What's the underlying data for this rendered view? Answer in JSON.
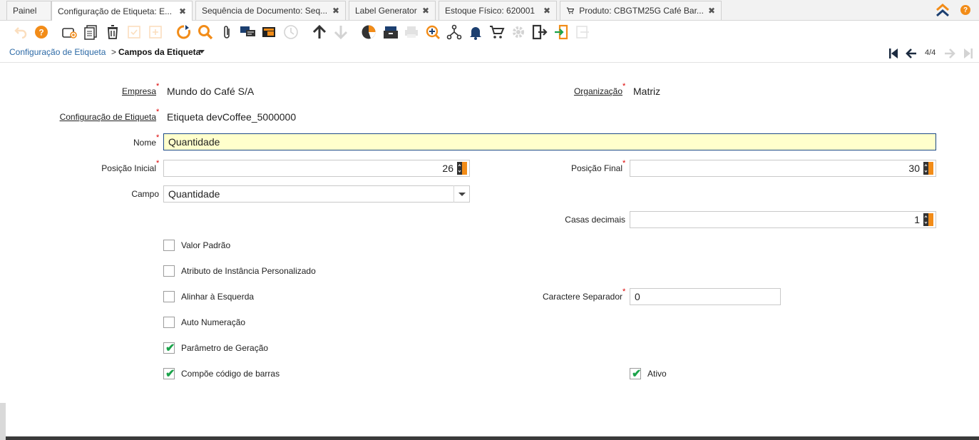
{
  "tabs": [
    {
      "label": "Painel",
      "closable": false
    },
    {
      "label": "Configuração de Etiqueta: E...",
      "closable": true,
      "active": true
    },
    {
      "label": "Sequência de Documento: Seq...",
      "closable": true
    },
    {
      "label": "Label Generator",
      "closable": true
    },
    {
      "label": "Estoque Físico: 620001",
      "closable": true
    },
    {
      "label": "Produto: CBGTM25G Café Bar...",
      "closable": true,
      "icon": "cart-icon"
    }
  ],
  "tab_close_glyph": "✖",
  "help_glyph": "?",
  "toolbar_icons": [
    "undo-icon",
    "help-icon",
    "new-record-icon",
    "copy-icon",
    "delete-icon",
    "save-icon",
    "save-new-icon",
    "refresh-icon",
    "find-icon",
    "attachment-icon",
    "chat-icon",
    "grid-toggle-icon",
    "history-icon",
    "parent-record-icon",
    "detail-record-icon",
    "report-icon",
    "archive-icon",
    "print-icon",
    "zoom-across-icon",
    "workflow-icon",
    "alert-icon",
    "cart-icon",
    "process-icon",
    "export-icon",
    "import-icon",
    "lock-icon"
  ],
  "breadcrumb": {
    "parent": "Configuração de Etiqueta",
    "separator": ">",
    "current": "Campos da Etiqueta"
  },
  "record_nav": {
    "count": "4/4"
  },
  "form": {
    "empresa": {
      "label": "Empresa",
      "value": "Mundo do Café S/A"
    },
    "organizacao": {
      "label": "Organização",
      "value": "Matriz"
    },
    "configuracao": {
      "label": "Configuração de Etiqueta",
      "value": "Etiqueta devCoffee_5000000"
    },
    "nome": {
      "label": "Nome",
      "value": "Quantidade"
    },
    "posicao_inicial": {
      "label": "Posição Inicial",
      "value": "26"
    },
    "posicao_final": {
      "label": "Posição Final",
      "value": "30"
    },
    "campo": {
      "label": "Campo",
      "value": "Quantidade"
    },
    "casas_decimais": {
      "label": "Casas decimais",
      "value": "1"
    },
    "caractere_separador": {
      "label": "Caractere Separador",
      "value": "0"
    },
    "checkboxes": [
      {
        "label": "Valor Padrão",
        "checked": false
      },
      {
        "label": "Atributo de Instância Personalizado",
        "checked": false
      },
      {
        "label": "Alinhar à Esquerda",
        "checked": false
      },
      {
        "label": "Auto Numeração",
        "checked": false
      },
      {
        "label": "Parâmetro de Geração",
        "checked": true
      },
      {
        "label": "Compõe código de barras",
        "checked": true
      }
    ],
    "ativo": {
      "label": "Ativo",
      "checked": true
    }
  },
  "required_mark": "*",
  "check_glyph": "✔",
  "colors": {
    "accent": "#f28c18",
    "link": "#2d6aa6",
    "required": "#dd0000",
    "focus_bg": "#ffffcc",
    "check": "#1aa34a"
  }
}
